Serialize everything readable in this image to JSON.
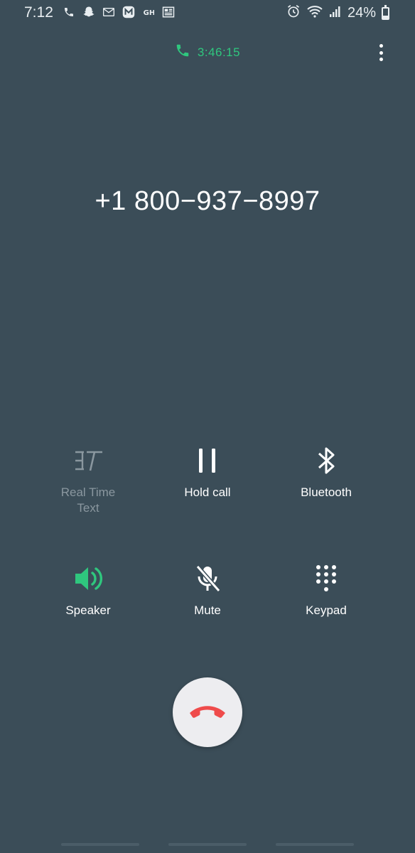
{
  "status_bar": {
    "time": "7:12",
    "battery_percent": "24%",
    "battery_level": 0.24,
    "left_icons": [
      "phone-icon",
      "snapchat-icon",
      "mail-icon",
      "m-app-icon",
      "gh-app-icon",
      "news-icon"
    ],
    "right_icons": [
      "alarm-icon",
      "wifi-icon",
      "signal-icon",
      "battery-icon"
    ]
  },
  "call": {
    "duration": "3:46:15",
    "phone_number": "+1 800−937−8997",
    "accent_color": "#2fc77e",
    "end_call_color": "#ef4b4b"
  },
  "controls": [
    {
      "label": "Real Time\nText",
      "label_line1": "Real Time",
      "label_line2": "Text",
      "icon": "rtt-icon",
      "enabled": false
    },
    {
      "label": "Hold call",
      "icon": "pause-icon",
      "enabled": true
    },
    {
      "label": "Bluetooth",
      "icon": "bluetooth-icon",
      "enabled": true
    },
    {
      "label": "Speaker",
      "icon": "speaker-icon",
      "enabled": true,
      "active": true
    },
    {
      "label": "Mute",
      "icon": "mic-off-icon",
      "enabled": true
    },
    {
      "label": "Keypad",
      "icon": "keypad-icon",
      "enabled": true
    }
  ],
  "colors": {
    "background": "#3b4d58",
    "disabled_text": "#8a979f",
    "end_call_bg": "#ededf0"
  }
}
